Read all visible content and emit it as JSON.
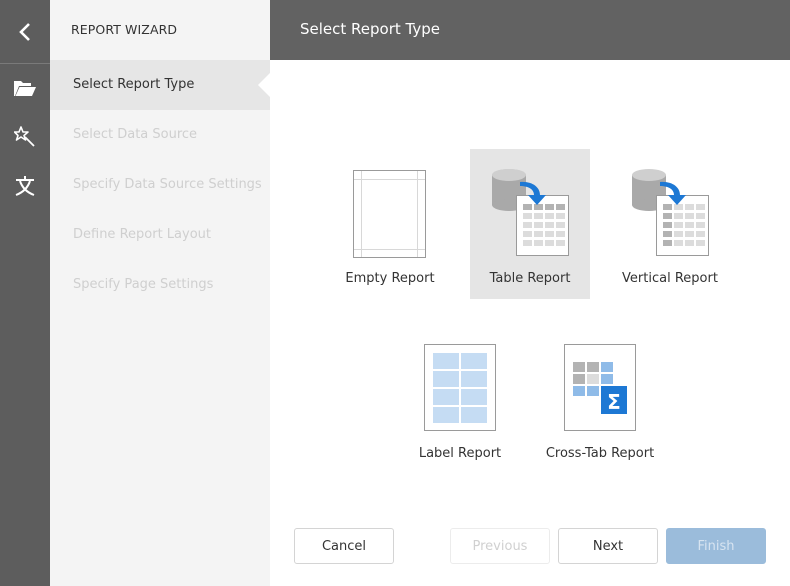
{
  "rail": {
    "back_icon": "chevron-left-icon",
    "items": [
      {
        "icon": "folder-open-icon",
        "label": "Open"
      },
      {
        "icon": "magic-wand-icon",
        "label": "Wizard"
      },
      {
        "icon": "localization-icon",
        "label": "Localization"
      }
    ]
  },
  "wizard": {
    "title": "REPORT WIZARD",
    "steps": [
      {
        "label": "Select Report Type",
        "state": "active"
      },
      {
        "label": "Select Data Source",
        "state": "disabled"
      },
      {
        "label": "Specify Data Source Settings",
        "state": "disabled"
      },
      {
        "label": "Define Report Layout",
        "state": "disabled"
      },
      {
        "label": "Specify Page Settings",
        "state": "disabled"
      }
    ]
  },
  "header": {
    "title": "Select Report Type"
  },
  "report_types": [
    {
      "label": "Empty Report",
      "icon": "empty-report-icon",
      "selected": false
    },
    {
      "label": "Table Report",
      "icon": "table-report-icon",
      "selected": true
    },
    {
      "label": "Vertical Report",
      "icon": "vertical-report-icon",
      "selected": false
    },
    {
      "label": "Label Report",
      "icon": "label-report-icon",
      "selected": false
    },
    {
      "label": "Cross-Tab Report",
      "icon": "cross-tab-report-icon",
      "selected": false
    }
  ],
  "buttons": {
    "cancel": "Cancel",
    "previous": "Previous",
    "next": "Next",
    "finish": "Finish"
  },
  "colors": {
    "rail_bg": "#5d5d5d",
    "header_bg": "#626262",
    "accent_blue": "#1d78d4",
    "finish_disabled": "#9bbcdb"
  }
}
